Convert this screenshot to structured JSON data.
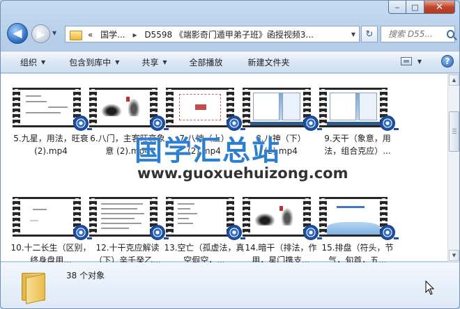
{
  "window": {
    "caption": {
      "minimize": "‒",
      "maximize": "□",
      "close": "✕"
    }
  },
  "nav": {
    "back_glyph": "◀",
    "forward_glyph": "▶",
    "address": {
      "prefix": "«",
      "crumb1": "国学...",
      "crumb2": "D5598 《端影奇门遁甲弟子班》函授视频3..."
    },
    "search_placeholder": "搜索 D55..."
  },
  "toolbar": {
    "organize": "组织",
    "include": "包含到库中",
    "share": "共享",
    "play_all": "全部播放",
    "new_folder": "新建文件夹"
  },
  "files": [
    {
      "name": "5.九星，用法，旺衰 (2).mp4"
    },
    {
      "name": "6.八门，主客旺衰象意 (2).mp4"
    },
    {
      "name": "7.八神（上）(2).mp4"
    },
    {
      "name": "8.八神（下）(2).mp4"
    },
    {
      "name": "9.天干（象意，用法，组合克应）..."
    },
    {
      "name": "10.十二长生（区别，终身盘用..."
    },
    {
      "name": "12.十干克应解读（下）辛壬癸乙..."
    },
    {
      "name": "13.空亡（孤虚法，真空假空，..."
    },
    {
      "name": "14.暗干（排法，作用，星门携支..."
    },
    {
      "name": "15.排盘（符头，节气，旬首，五..."
    }
  ],
  "details": {
    "count": "38 个对象"
  },
  "watermark": {
    "cn": "国学汇总站",
    "url": "www.guoxuehuizong.com"
  },
  "colors": {
    "accent": "#2f7fd0",
    "command_bar": "#dbe7f5",
    "content_bg": "#ffffff"
  },
  "icons": [
    "back-arrow-icon",
    "forward-arrow-icon",
    "folder-icon",
    "refresh-icon",
    "search-icon",
    "view-icon",
    "help-icon",
    "video-reel-icon",
    "big-folder-icon",
    "mouse-cursor-icon"
  ]
}
